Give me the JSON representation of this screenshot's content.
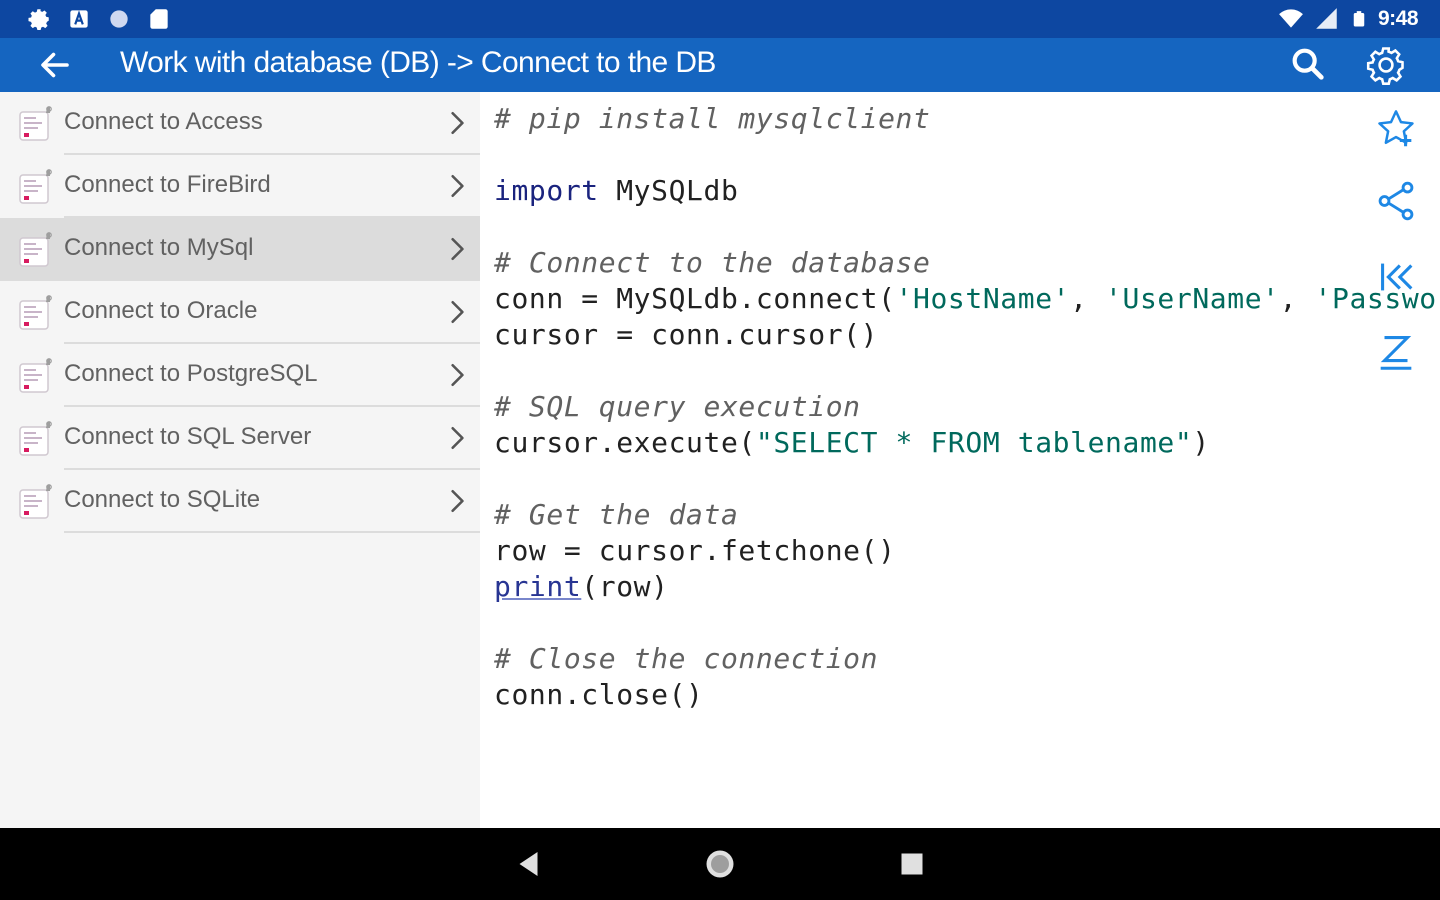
{
  "status_bar": {
    "time": "9:48",
    "icons": [
      "gear-icon",
      "a-icon",
      "circle-icon",
      "sd-card-icon",
      "wifi-icon",
      "signal-icon",
      "battery-icon"
    ]
  },
  "app_bar": {
    "title": "Work with database (DB) -> Connect to the DB",
    "icons": [
      "back-arrow-icon",
      "search-icon",
      "settings-icon"
    ],
    "color": "#1565c0",
    "status_color": "#0d47a1"
  },
  "list": {
    "items": [
      {
        "label": "Connect to Access",
        "selected": false
      },
      {
        "label": "Connect to FireBird",
        "selected": false
      },
      {
        "label": "Connect to MySql",
        "selected": true
      },
      {
        "label": "Connect to Oracle",
        "selected": false
      },
      {
        "label": "Connect to PostgreSQL",
        "selected": false
      },
      {
        "label": "Connect to SQL Server",
        "selected": false
      },
      {
        "label": "Connect to SQLite",
        "selected": false
      }
    ]
  },
  "code": {
    "lines": [
      [
        {
          "t": "# pip install mysqlclient",
          "k": "comment"
        }
      ],
      [],
      [
        {
          "t": "import",
          "k": "kw"
        },
        {
          "t": " MySQLdb",
          "k": "plain"
        }
      ],
      [],
      [
        {
          "t": "# Connect to the database",
          "k": "comment"
        }
      ],
      [
        {
          "t": "conn = MySQLdb.connect(",
          "k": "plain"
        },
        {
          "t": "'HostName'",
          "k": "str"
        },
        {
          "t": ", ",
          "k": "plain"
        },
        {
          "t": "'UserName'",
          "k": "str"
        },
        {
          "t": ", ",
          "k": "plain"
        },
        {
          "t": "'Passwor",
          "k": "str"
        }
      ],
      [
        {
          "t": "cursor = conn.cursor()",
          "k": "plain"
        }
      ],
      [],
      [
        {
          "t": "# SQL query execution",
          "k": "comment"
        }
      ],
      [
        {
          "t": "cursor.execute(",
          "k": "plain"
        },
        {
          "t": "\"SELECT * FROM tablename\"",
          "k": "str"
        },
        {
          "t": ")",
          "k": "plain"
        }
      ],
      [],
      [
        {
          "t": "# Get the data",
          "k": "comment"
        }
      ],
      [
        {
          "t": "row = cursor.fetchone()",
          "k": "plain"
        }
      ],
      [
        {
          "t": "print",
          "k": "builtin"
        },
        {
          "t": "(row)",
          "k": "plain"
        }
      ],
      [],
      [
        {
          "t": "# Close the connection",
          "k": "comment"
        }
      ],
      [
        {
          "t": "conn.close()",
          "k": "plain"
        }
      ]
    ]
  },
  "side_actions": [
    "add-favorite-icon",
    "share-icon",
    "first-page-icon",
    "sort-icon"
  ],
  "nav_bar": [
    "nav-back-icon",
    "nav-home-icon",
    "nav-recents-icon"
  ],
  "accent_color": "#1e88e5"
}
